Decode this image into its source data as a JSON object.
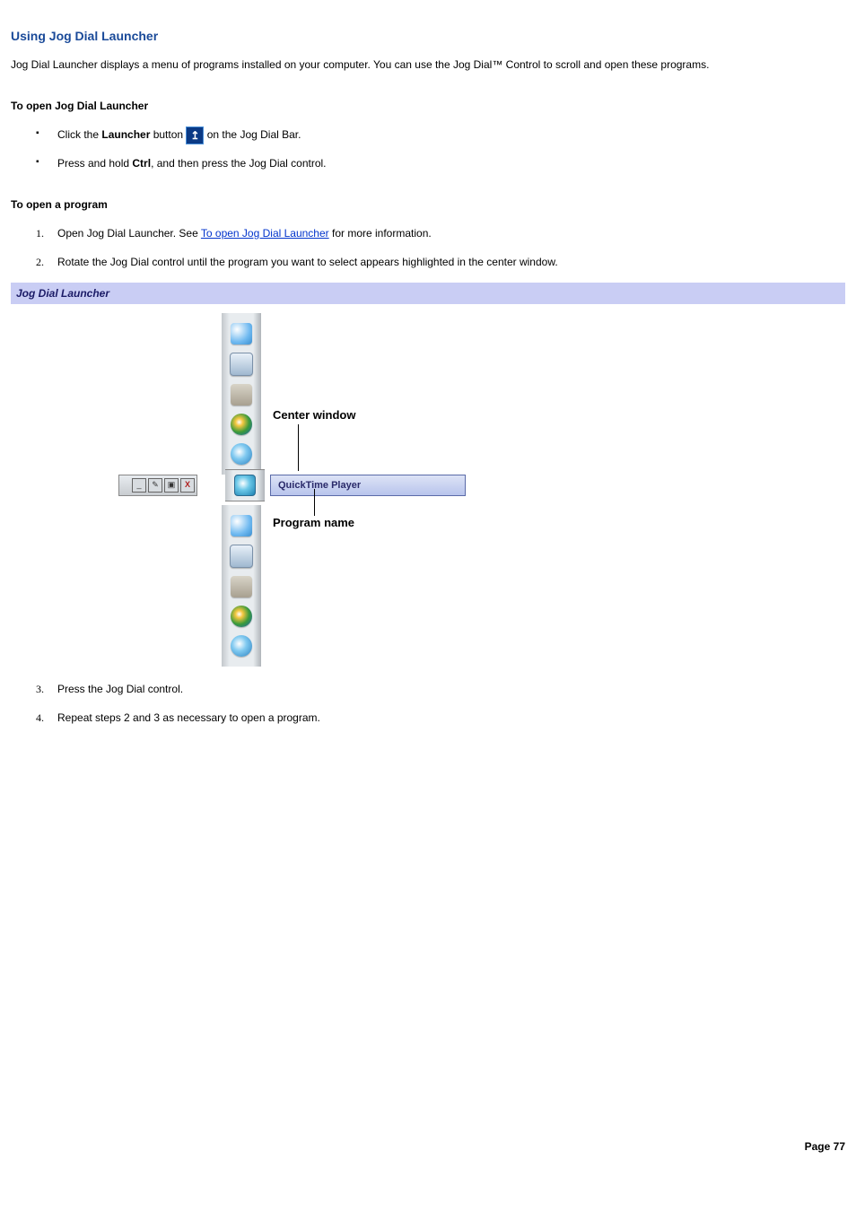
{
  "title": "Using Jog Dial Launcher",
  "intro": "Jog Dial Launcher displays a menu of programs installed on your computer. You can use the Jog Dial™ Control to scroll and open these programs.",
  "sections": {
    "open_launcher_heading": "To open Jog Dial Launcher",
    "open_program_heading": "To open a program"
  },
  "bullets": {
    "launcher_click_prefix": "Click the ",
    "launcher_bold": "Launcher",
    "launcher_click_middle": " button ",
    "launcher_click_suffix": " on the Jog Dial Bar.",
    "ctrl_prefix": "Press and hold ",
    "ctrl_bold": "Ctrl",
    "ctrl_suffix": ", and then press the Jog Dial control."
  },
  "steps": {
    "s1_prefix": "Open Jog Dial Launcher. See ",
    "s1_link": "To open Jog Dial Launcher",
    "s1_suffix": " for more information.",
    "s2": "Rotate the Jog Dial control until the program you want to select appears highlighted in the center window.",
    "s3": "Press the Jog Dial control.",
    "s4": "Repeat steps 2 and 3 as necessary to open a program."
  },
  "caption": "Jog Dial Launcher",
  "screenshot": {
    "center_window_label": "Center window",
    "program_name_label": "Program name",
    "tooltip": "QuickTime Player"
  },
  "footer": "Page 77"
}
